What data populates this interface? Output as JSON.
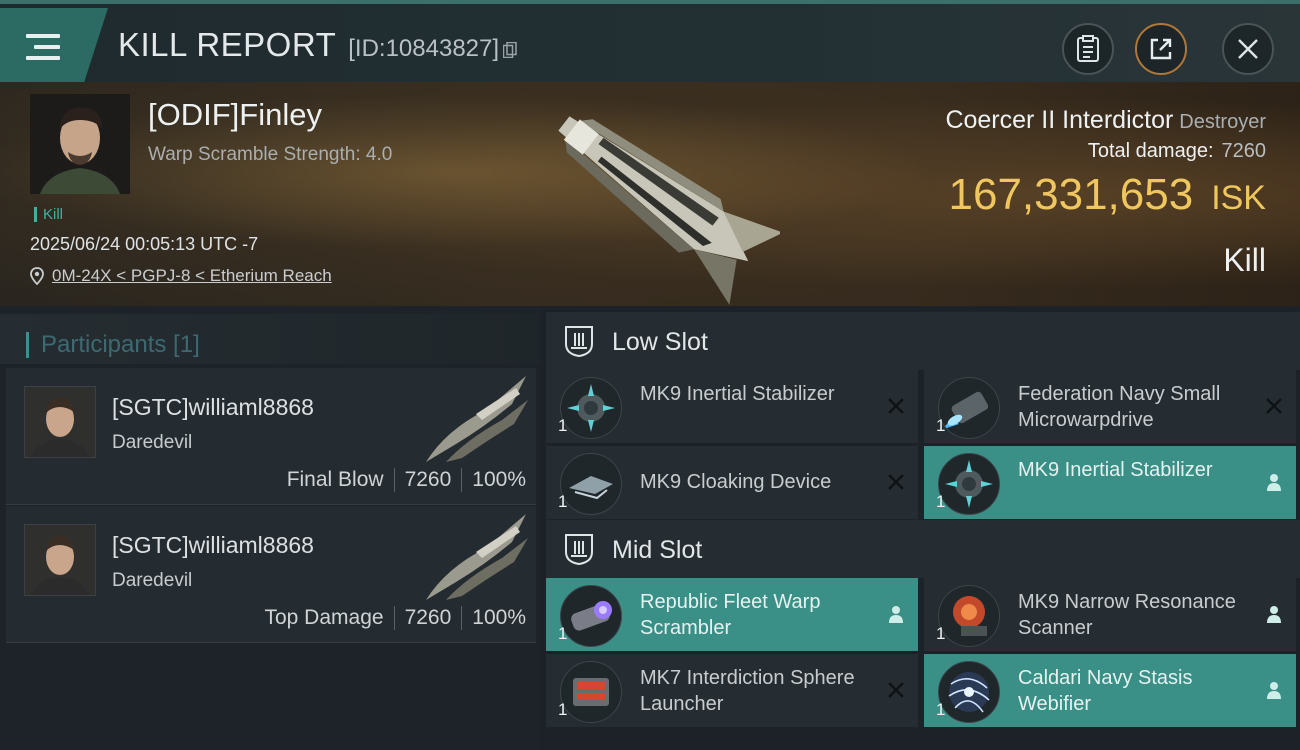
{
  "header": {
    "title": "KILL REPORT",
    "kill_id": "[ID:10843827]"
  },
  "victim": {
    "name": "[ODIF]Finley",
    "scramble_text": "Warp Scramble Strength: 4.0",
    "tag": "Kill",
    "datetime": "2025/06/24 00:05:13 UTC -7",
    "location": "0M-24X < PGPJ-8 < Etherium Reach"
  },
  "ship": {
    "name": "Coercer II Interdictor",
    "class": "Destroyer",
    "total_damage_label": "Total damage:",
    "total_damage_value": "7260",
    "isk_value": "167,331,653",
    "isk_unit": "ISK",
    "result": "Kill"
  },
  "participants": {
    "title": "Participants [1]",
    "items": [
      {
        "name": "[SGTC]williaml8868",
        "ship": "Daredevil",
        "role": "Final Blow",
        "damage": "7260",
        "percent": "100%"
      },
      {
        "name": "[SGTC]williaml8868",
        "ship": "Daredevil",
        "role": "Top Damage",
        "damage": "7260",
        "percent": "100%"
      }
    ]
  },
  "slots": {
    "low": {
      "label": "Low Slot",
      "modules": [
        {
          "name": "MK9 Inertial Stabilizer",
          "qty": "1",
          "status": "destroyed",
          "icon": "inertial-stabilizer-icon"
        },
        {
          "name": "Federation Navy Small Microwarpdrive",
          "qty": "1",
          "status": "destroyed",
          "icon": "microwarpdrive-icon"
        },
        {
          "name": "MK9 Cloaking Device",
          "qty": "1",
          "status": "destroyed",
          "icon": "cloaking-device-icon"
        },
        {
          "name": "MK9 Inertial Stabilizer",
          "qty": "1",
          "status": "dropped",
          "icon": "inertial-stabilizer-icon"
        }
      ]
    },
    "mid": {
      "label": "Mid Slot",
      "modules": [
        {
          "name": "Republic Fleet Warp Scrambler",
          "qty": "1",
          "status": "dropped",
          "icon": "warp-scrambler-icon"
        },
        {
          "name": "MK9 Narrow Resonance Scanner",
          "qty": "1",
          "status": "dropped",
          "icon": "resonance-scanner-icon"
        },
        {
          "name": "MK7 Interdiction Sphere Launcher",
          "qty": "1",
          "status": "destroyed",
          "icon": "sphere-launcher-icon"
        },
        {
          "name": "Caldari Navy Stasis Webifier",
          "qty": "1",
          "status": "dropped",
          "icon": "stasis-webifier-icon"
        }
      ]
    }
  },
  "colors": {
    "accent_teal": "#3a8f86",
    "isk_gold": "#f0c75e",
    "menu_tab": "#2c6a64"
  }
}
